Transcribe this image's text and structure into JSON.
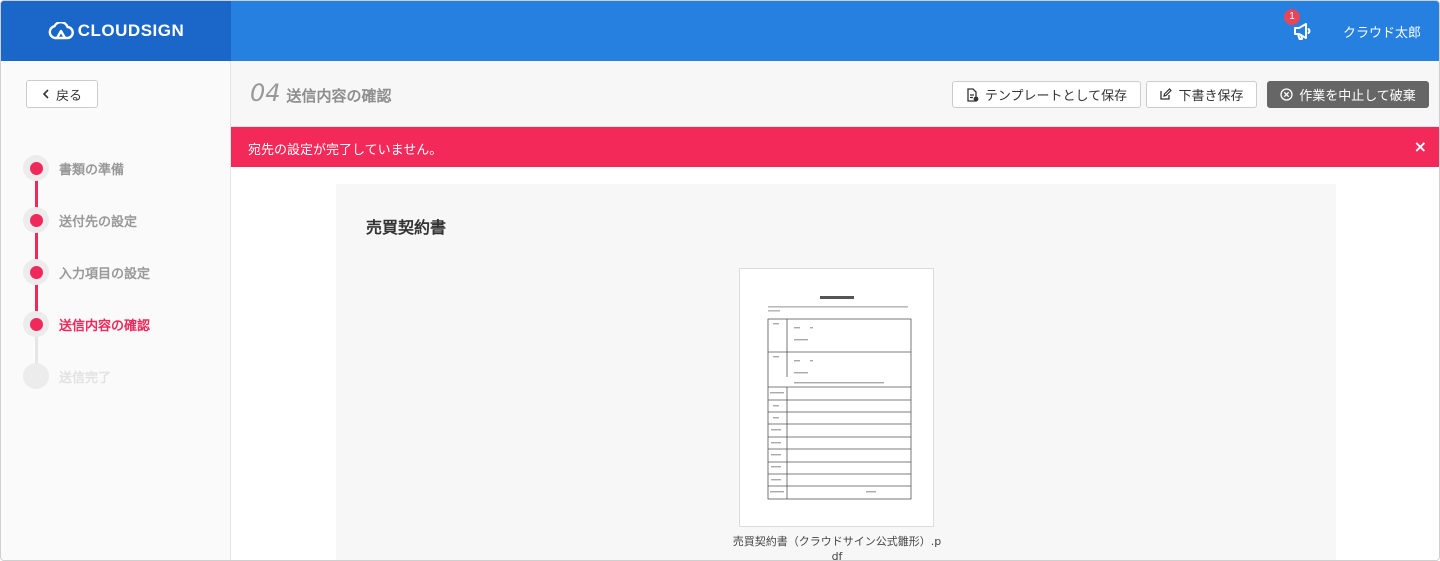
{
  "header": {
    "logo_text": "CLOUDSIGN",
    "notification_count": "1",
    "user_name": "クラウド太郎"
  },
  "toolbar": {
    "back_label": "戻る",
    "step_number": "04",
    "step_title": "送信内容の確認",
    "save_template_label": "テンプレートとして保存",
    "save_draft_label": "下書き保存",
    "abort_label": "作業を中止して破棄"
  },
  "steps": [
    {
      "label": "書類の準備",
      "state": "done"
    },
    {
      "label": "送付先の設定",
      "state": "done"
    },
    {
      "label": "入力項目の設定",
      "state": "done"
    },
    {
      "label": "送信内容の確認",
      "state": "current"
    },
    {
      "label": "送信完了",
      "state": "pending"
    }
  ],
  "alert": {
    "message": "宛先の設定が完了していません。",
    "close_symbol": "×"
  },
  "document": {
    "title": "売買契約書",
    "file_name": "売買契約書（クラウドサイン公式雛形）.pdf"
  },
  "colors": {
    "header_blue": "#2580e0",
    "logo_blue": "#1a66c9",
    "accent_pink": "#f0295b",
    "alert_pink": "#f3295a"
  }
}
